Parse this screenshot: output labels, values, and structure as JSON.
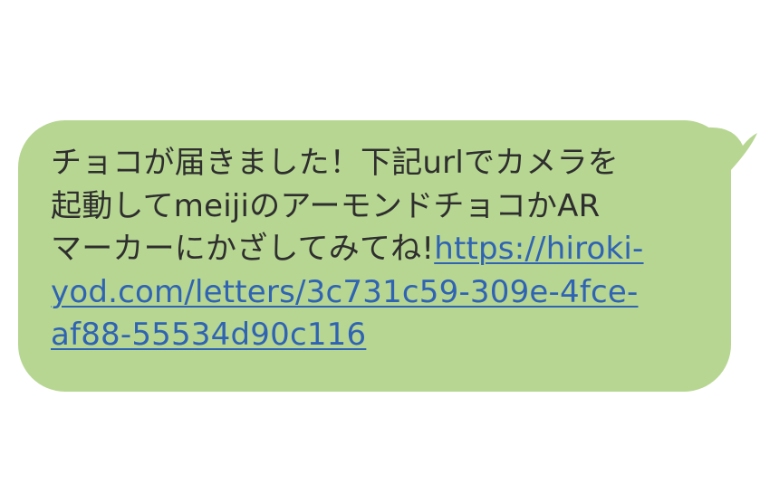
{
  "message": {
    "bubble_color": "#b7d692",
    "link_color": "#2f63b3",
    "lines": [
      "チョコが届きました！下記urlでカメラを",
      "起動してmeijiのアーモンドチョコかAR",
      "マーカーにかざしてみてね!"
    ],
    "link": {
      "line1": "https://hiroki-",
      "line2": "yod.com/letters/3c731c59-309e-4fce-",
      "line3": "af88-55534d90c116"
    }
  }
}
